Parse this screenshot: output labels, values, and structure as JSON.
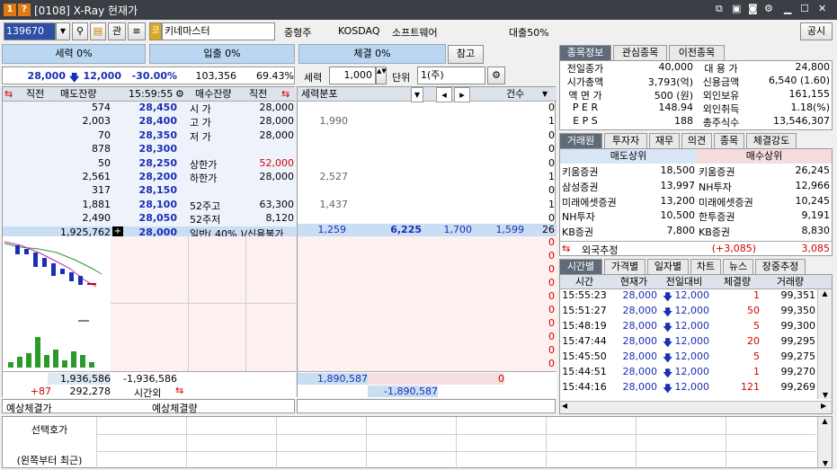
{
  "window": {
    "title": "[0108] X-Ray 현재가",
    "icon1": "1",
    "icon2": "?"
  },
  "toolbar": {
    "code": "139670",
    "gwan": "관",
    "market_badge": "코",
    "stock_name": "키네마스터",
    "size_class": "중형주",
    "market": "KOSDAQ",
    "sector": "소프트웨어",
    "loan": "대출50%",
    "notice": "공시"
  },
  "buttons": {
    "power": "세력 0%",
    "inflow": "입출 0%",
    "contract": "체결 0%",
    "ref": "참고"
  },
  "price_row": {
    "price": "28,000",
    "change": "12,000",
    "rate": "-30.00%",
    "volume": "103,356",
    "ratio": "69.43%"
  },
  "contract_ctl": {
    "label": "세력",
    "value": "1,000",
    "unit_label": "단위",
    "unit_value": "1(주)"
  },
  "orderbook": {
    "headers": {
      "prev1": "직전",
      "sell": "매도잔량",
      "time": "15:59:55",
      "buy": "매수잔량",
      "prev2": "직전"
    },
    "asks": [
      {
        "qty": "574",
        "price": "28,450",
        "label": "시  가",
        "val": "28,000"
      },
      {
        "qty": "2,003",
        "price": "28,400",
        "label": "고  가",
        "val": "28,000"
      },
      {
        "qty": "70",
        "price": "28,350",
        "label": "저  가",
        "val": "28,000"
      },
      {
        "qty": "878",
        "price": "28,300",
        "label": "",
        "val": ""
      },
      {
        "qty": "50",
        "price": "28,250",
        "label": "상한가",
        "val": "52,000"
      },
      {
        "qty": "2,561",
        "price": "28,200",
        "label": "하한가",
        "val": "28,000"
      },
      {
        "qty": "317",
        "price": "28,150",
        "label": "",
        "val": ""
      },
      {
        "qty": "1,881",
        "price": "28,100",
        "label": "52주고",
        "val": "63,300"
      },
      {
        "qty": "2,490",
        "price": "28,050",
        "label": "52주저",
        "val": "8,120"
      },
      {
        "qty": "1,925,762",
        "price": "28,000",
        "label": "일반( 40% )/신용불가",
        "val": ""
      }
    ],
    "total_sell": "1,936,586",
    "total_diff": "-1,936,586",
    "extra_l": "+87",
    "extra_qty": "292,278",
    "after_hours": "시간외"
  },
  "dist": {
    "header": "세력분포",
    "count_header": "건수",
    "rows": [
      {
        "v": "",
        "n": "0"
      },
      {
        "v": "1,990",
        "n": "1"
      },
      {
        "v": "",
        "n": "0"
      },
      {
        "v": "",
        "n": "0"
      },
      {
        "v": "",
        "n": "0"
      },
      {
        "v": "2,527",
        "n": "1"
      },
      {
        "v": "",
        "n": "0"
      },
      {
        "v": "1,437",
        "n": "1"
      },
      {
        "v": "",
        "n": "0"
      }
    ],
    "cur": {
      "a": "1,259",
      "b": "6,225",
      "c": "1,700",
      "d": "1,599",
      "n": "26"
    },
    "buy_counts": [
      "0",
      "0",
      "0",
      "0",
      "0",
      "0",
      "0",
      "0",
      "0",
      "0"
    ],
    "sum1": "1,890,587",
    "sum1b": "0",
    "sum2": "-1,890,587"
  },
  "expected": {
    "price_label": "예상체결가",
    "qty_label": "예상체결량"
  },
  "bottom": {
    "label1": "선택호가",
    "label2": "(왼쪽부터 최근)"
  },
  "info_tabs": [
    "종목정보",
    "관심종목",
    "이전종목"
  ],
  "info": [
    [
      "전일종가",
      "40,000",
      "대 용 가",
      "24,800"
    ],
    [
      "시가총액",
      "3,793(억)",
      "신용금액",
      "6,540  (1.60)"
    ],
    [
      "액 면 가",
      "500 (원)",
      "외인보유",
      "161,155"
    ],
    [
      "P E R",
      "148.94",
      "외인취득",
      "1.18(%)"
    ],
    [
      "E P S",
      "188",
      "총주식수",
      "13,546,307"
    ]
  ],
  "broker_tabs": [
    "거래원",
    "투자자",
    "재무",
    "의견",
    "종목",
    "체결강도"
  ],
  "broker": {
    "sell_title": "매도상위",
    "buy_title": "매수상위",
    "rows": [
      [
        "키움증권",
        "18,500",
        "키움증권",
        "26,245"
      ],
      [
        "삼성증권",
        "13,997",
        "NH투자",
        "12,966"
      ],
      [
        "미래에셋증권",
        "13,200",
        "미래에셋증권",
        "10,245"
      ],
      [
        "NH투자",
        "10,500",
        "한투증권",
        "9,191"
      ],
      [
        "KB증권",
        "7,800",
        "KB증권",
        "8,830"
      ]
    ],
    "foreign_label": "외국추정",
    "foreign_sell": "(+3,085)",
    "foreign_buy": "3,085"
  },
  "time_tabs": [
    "시간별",
    "가격별",
    "일자별",
    "차트",
    "뉴스",
    "장중추정"
  ],
  "ticks": {
    "headers": [
      "시간",
      "현재가",
      "전일대비",
      "체결량",
      "거래량"
    ],
    "rows": [
      [
        "15:55:23",
        "28,000",
        "12,000",
        "1",
        "99,351"
      ],
      [
        "15:51:27",
        "28,000",
        "12,000",
        "50",
        "99,350"
      ],
      [
        "15:48:19",
        "28,000",
        "12,000",
        "5",
        "99,300"
      ],
      [
        "15:47:44",
        "28,000",
        "12,000",
        "20",
        "99,295"
      ],
      [
        "15:45:50",
        "28,000",
        "12,000",
        "5",
        "99,275"
      ],
      [
        "15:44:51",
        "28,000",
        "12,000",
        "1",
        "99,270"
      ],
      [
        "15:44:16",
        "28,000",
        "12,000",
        "121",
        "99,269"
      ]
    ]
  },
  "colors": {
    "blue": "#1a2fb5",
    "red": "#d40000",
    "tab_active": "#5f6b78"
  }
}
